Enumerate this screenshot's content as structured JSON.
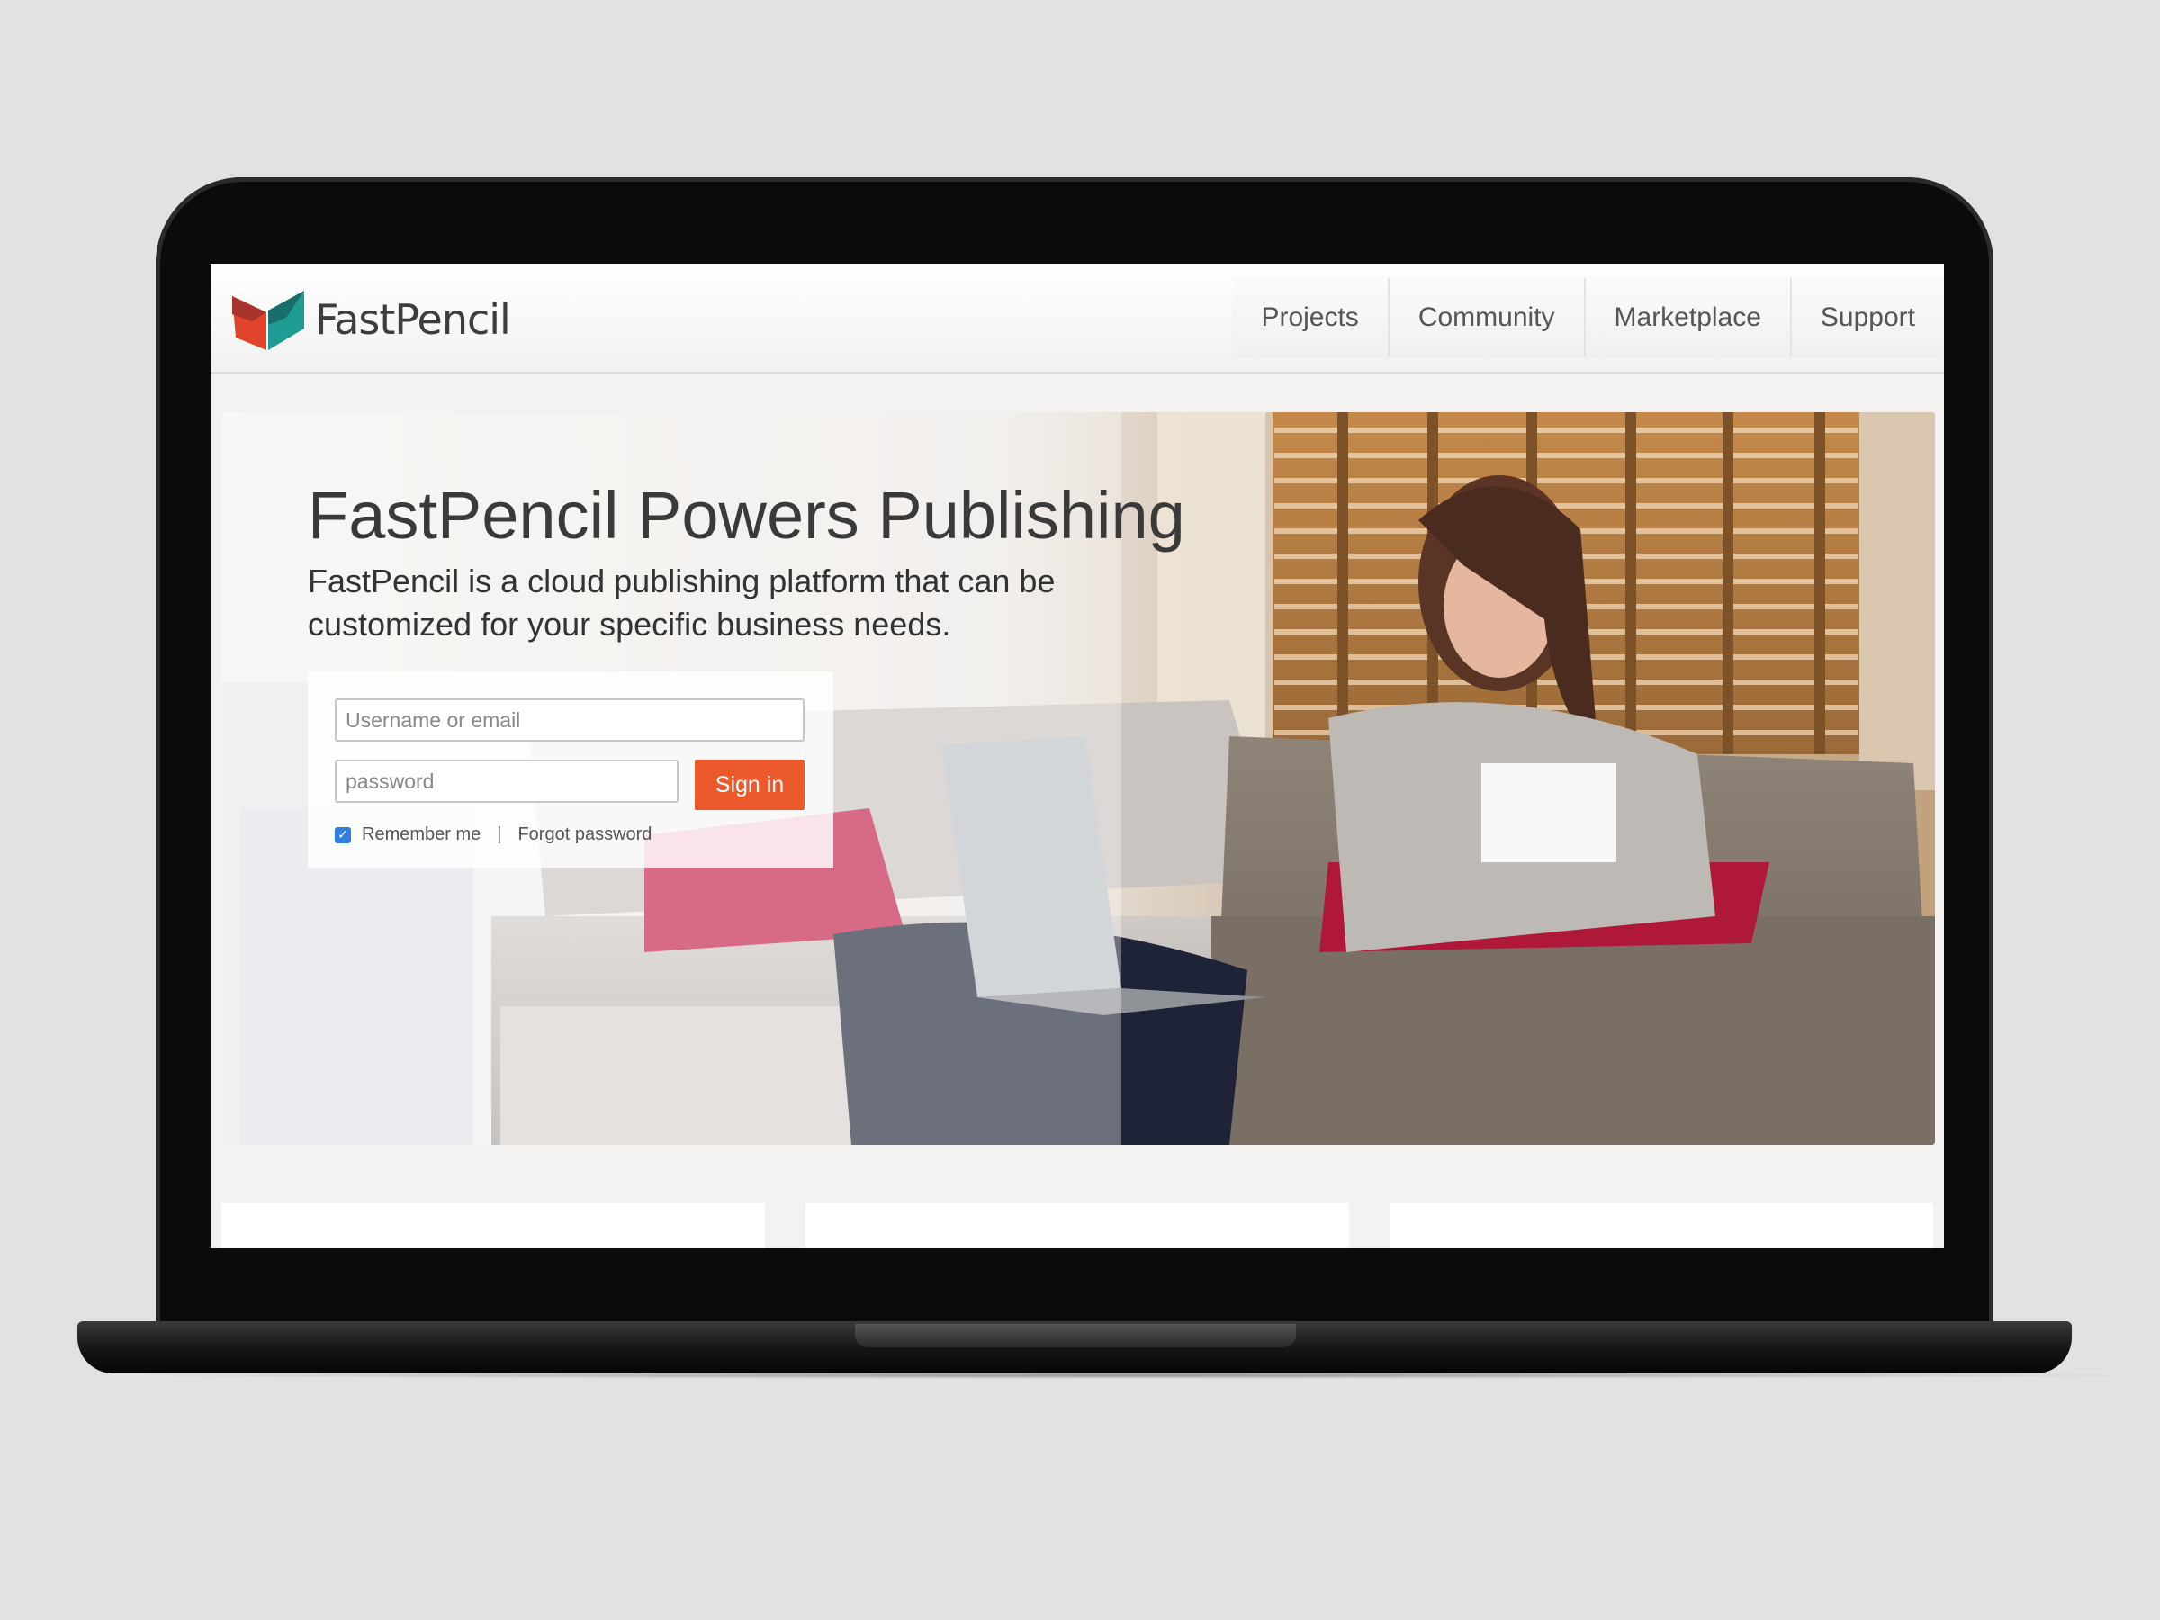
{
  "brand": {
    "name": "FastPencil",
    "colors": {
      "red": "#e0442b",
      "teal": "#1e9c94",
      "dark_red": "#8e2c2a",
      "dark_teal": "#176e6a"
    }
  },
  "nav": {
    "items": [
      "Projects",
      "Community",
      "Marketplace",
      "Support"
    ]
  },
  "hero": {
    "title": "FastPencil Powers Publishing",
    "subtitle": "FastPencil is a cloud publishing platform that can be customized for your specific business needs.",
    "image_subject": "woman on sofa using laptop"
  },
  "login": {
    "username_placeholder": "Username or email",
    "password_placeholder": "password",
    "signin_label": "Sign in",
    "remember_label": "Remember me",
    "separator": "|",
    "forgot_label": "Forgot password",
    "remember_checked": true,
    "accent_color": "#ec5a2c"
  },
  "icons": {
    "checkbox": "check-icon"
  }
}
